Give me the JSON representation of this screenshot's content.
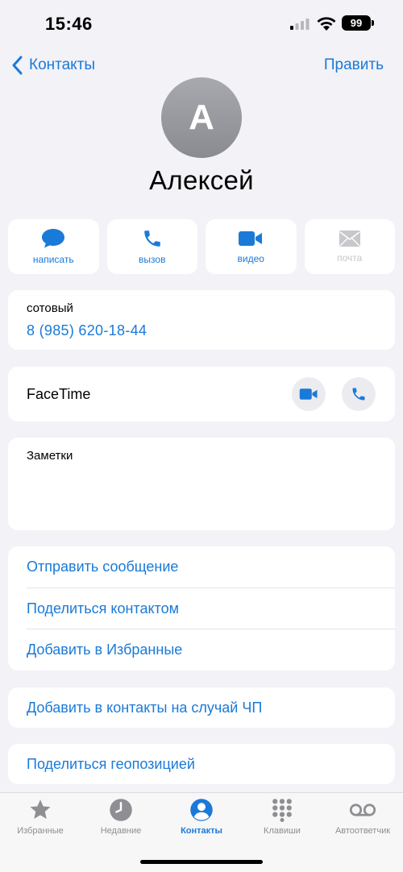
{
  "status_bar": {
    "time": "15:46",
    "battery": "99"
  },
  "nav": {
    "back_label": "Контакты",
    "edit_label": "Править"
  },
  "contact": {
    "initial": "А",
    "name": "Алексей"
  },
  "actions": [
    {
      "label": "написать",
      "icon": "message-icon",
      "enabled": true
    },
    {
      "label": "вызов",
      "icon": "phone-icon",
      "enabled": true
    },
    {
      "label": "видео",
      "icon": "video-icon",
      "enabled": true
    },
    {
      "label": "почта",
      "icon": "mail-icon",
      "enabled": false
    }
  ],
  "phone": {
    "label": "сотовый",
    "number": "8 (985) 620-18-44"
  },
  "facetime": {
    "label": "FaceTime"
  },
  "notes": {
    "label": "Заметки"
  },
  "links": [
    "Отправить сообщение",
    "Поделиться контактом",
    "Добавить в Избранные"
  ],
  "emergency_link": "Добавить в контакты на случай ЧП",
  "location_link": "Поделиться геопозицией",
  "tabs": [
    {
      "label": "Избранные",
      "icon": "star-icon",
      "active": false
    },
    {
      "label": "Недавние",
      "icon": "clock-icon",
      "active": false
    },
    {
      "label": "Контакты",
      "icon": "person-icon",
      "active": true
    },
    {
      "label": "Клавиши",
      "icon": "keypad-icon",
      "active": false
    },
    {
      "label": "Автоответчик",
      "icon": "voicemail-icon",
      "active": false
    }
  ],
  "colors": {
    "accent": "#1a7ad8",
    "background": "#f2f2f7",
    "inactive": "#8e8e93"
  }
}
